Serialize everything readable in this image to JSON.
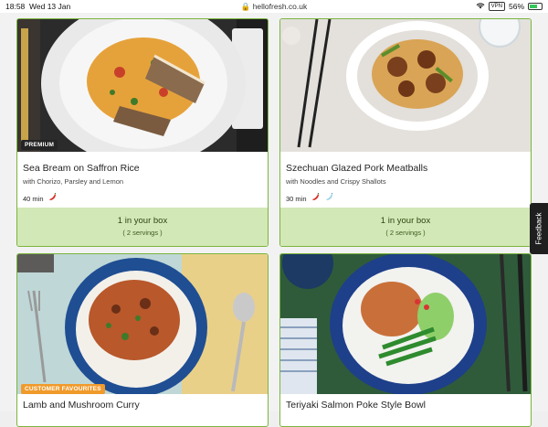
{
  "statusbar": {
    "time": "18:58",
    "date": "Wed 13 Jan",
    "url": "hellofresh.co.uk",
    "vpn": "VPN",
    "battery": "56%"
  },
  "recipes": [
    {
      "title": "Sea Bream on Saffron Rice",
      "subtitle": "with Chorizo, Parsley and Lemon",
      "tag": "PREMIUM",
      "time": "40 min",
      "icons": [
        "chili-icon"
      ],
      "box_label": "1 in your box",
      "servings": "( 2 servings )"
    },
    {
      "title": "Szechuan Glazed Pork Meatballs",
      "subtitle": "with Noodles and Crispy Shallots",
      "time": "30 min",
      "icons": [
        "chili-icon",
        "pepper-icon"
      ],
      "box_label": "1 in your box",
      "servings": "( 2 servings )"
    },
    {
      "title": "Lamb and Mushroom Curry",
      "tag": "CUSTOMER FAVOURITES"
    },
    {
      "title": "Teriyaki Salmon Poke Style Bowl"
    }
  ],
  "feedback": "Feedback",
  "colors": {
    "card_border": "#7bb53e",
    "box_bg": "#d3e8b7",
    "premium_tag": "#242424",
    "favourites_tag": "#f09a2b"
  }
}
